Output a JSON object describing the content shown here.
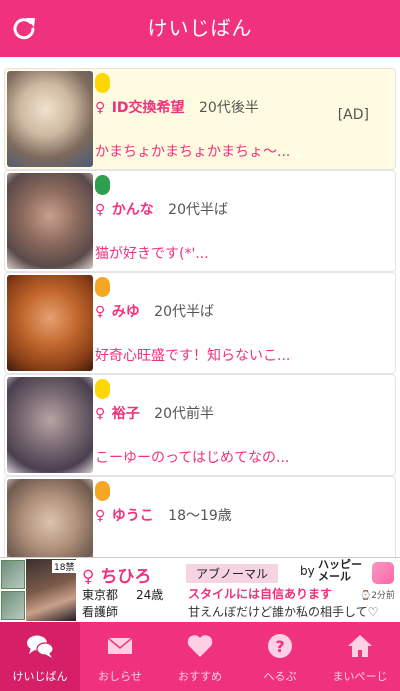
{
  "header": {
    "title": "けいじばん"
  },
  "posts": [
    {
      "status_color": "#ffd700",
      "gender": "♀",
      "name": "ID交換希望",
      "age": "20代後半",
      "message": "かまちょかまちょかまちょ～...",
      "ad_label": "[AD]"
    },
    {
      "status_color": "#2e9e4f",
      "gender": "♀",
      "name": "かんな",
      "age": "20代半ば",
      "message": "猫が好きです(*'..."
    },
    {
      "status_color": "#f5a623",
      "gender": "♀",
      "name": "みゆ",
      "age": "20代半ば",
      "message": "好奇心旺盛です！知らないこ..."
    },
    {
      "status_color": "#ffd700",
      "gender": "♀",
      "name": "裕子",
      "age": "20代前半",
      "message": "こーゆーのってはじめてなの..."
    },
    {
      "status_color": "#f5a623",
      "gender": "♀",
      "name": "ゆうこ",
      "age": "18〜19歳",
      "message": ""
    }
  ],
  "banner": {
    "rating": "18禁",
    "name": "♀ ちひろ",
    "prefecture": "東京都",
    "age": "24歳",
    "job": "看護師",
    "category": "アブノーマル",
    "by": "by",
    "brand_line1": "ハッピー",
    "brand_line2": "メール",
    "tagline": "スタイルには自信あります",
    "time": "⌚2分前",
    "message": "甘えんぼだけど誰か私の相手して♡"
  },
  "tabs": [
    {
      "label": "けいじばん",
      "icon": "chat-bubbles-icon",
      "active": true
    },
    {
      "label": "おしらせ",
      "icon": "mail-icon",
      "active": false
    },
    {
      "label": "おすすめ",
      "icon": "heart-icon",
      "active": false
    },
    {
      "label": "へるぷ",
      "icon": "help-icon",
      "active": false
    },
    {
      "label": "まいぺーじ",
      "icon": "home-icon",
      "active": false
    }
  ],
  "colors": {
    "accent": "#f0317d",
    "ad_background": "#fffbe0"
  }
}
